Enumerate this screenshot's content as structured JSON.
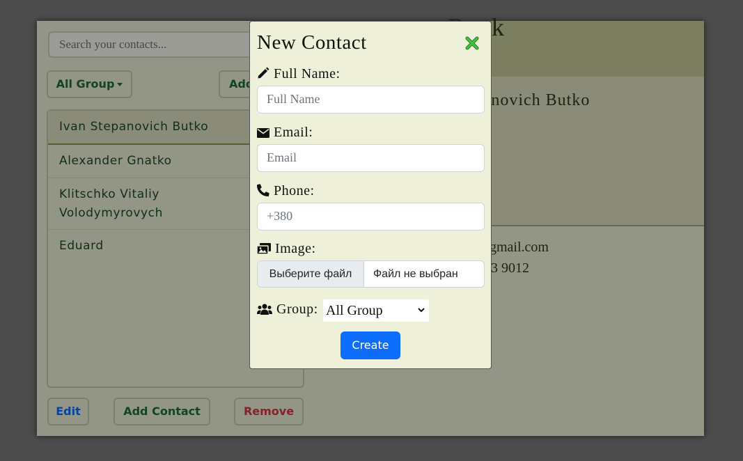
{
  "search": {
    "placeholder": "Search your contacts..."
  },
  "toolbar": {
    "group_filter": "All Group",
    "add_partial": "Add"
  },
  "contacts": [
    {
      "name": "Ivan Stepanovich Butko"
    },
    {
      "name": "Alexander Gnatko"
    },
    {
      "name": "Klitschko Vitaliy Volodymyrovych"
    },
    {
      "name": "Eduard"
    }
  ],
  "header": {
    "title_partial": "cts Book"
  },
  "detail": {
    "name_partial": "n Stepanovich Butko",
    "email_partial": "gmail.com",
    "phone_partial": "3 9012"
  },
  "bottom": {
    "edit_label": "Edit",
    "add_label": "Add Contact",
    "remove_label": "Remove"
  },
  "modal": {
    "title": "New Contact",
    "full_name_label": "Full Name:",
    "full_name_placeholder": "Full Name",
    "email_label": "Email:",
    "email_placeholder": "Email",
    "phone_label": "Phone:",
    "phone_placeholder": "+380",
    "image_label": "Image:",
    "file_button": "Выберите файл",
    "file_status": "Файл не выбран",
    "group_label": "Group:",
    "group_value": "All Group",
    "create_label": "Create"
  },
  "colors": {
    "accent_green": "#1e6e3a",
    "edit_blue": "#0d6efd",
    "remove_red": "#dc3545",
    "create_blue": "#0d6efd",
    "close_green": "#3ec43e"
  },
  "icons": [
    "pencil-icon",
    "envelope-icon",
    "phone-icon",
    "images-icon",
    "users-icon",
    "close-icon",
    "chevron-down-icon"
  ]
}
